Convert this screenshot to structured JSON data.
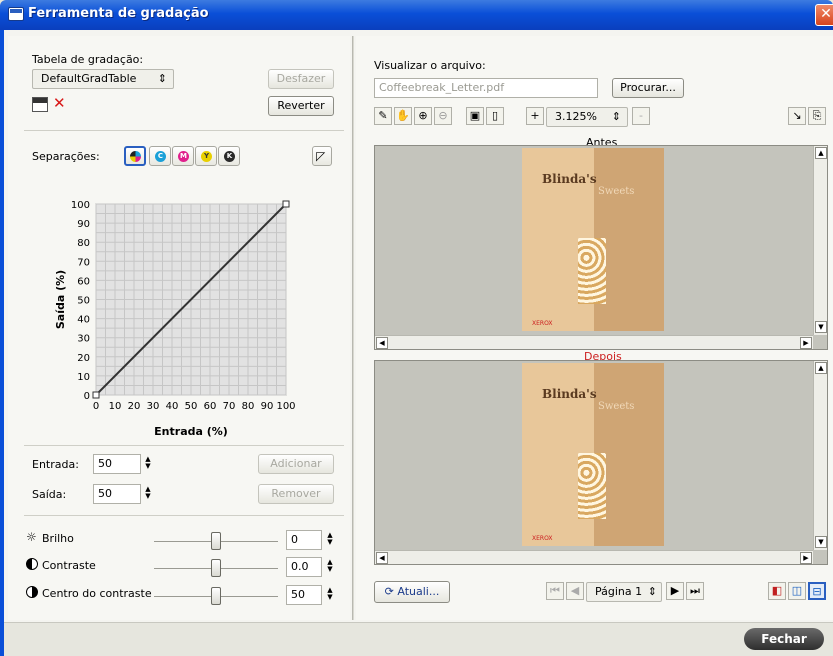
{
  "window": {
    "title": "Ferramenta de gradação",
    "close_glyph": "✕"
  },
  "left": {
    "gradation_table_label": "Tabela de gradação:",
    "gradation_table_value": "DefaultGradTable",
    "undo_label": "Desfazer",
    "revert_label": "Reverter",
    "separations_label": "Separações:",
    "separations": [
      {
        "name": "CMYK",
        "color": "#000000"
      },
      {
        "name": "C",
        "glyph": "C",
        "color": "#1aa0d8"
      },
      {
        "name": "M",
        "glyph": "M",
        "color": "#e0208c"
      },
      {
        "name": "Y",
        "glyph": "Y",
        "color": "#e8d000"
      },
      {
        "name": "K",
        "glyph": "K",
        "color": "#2a2a2a"
      }
    ],
    "input_label": "Entrada:",
    "input_value": "50",
    "output_label": "Saída:",
    "output_value": "50",
    "add_label": "Adicionar",
    "remove_label": "Remover",
    "brightness_label": "Brilho",
    "brightness_value": "0",
    "contrast_label": "Contraste",
    "contrast_value": "0.0",
    "contrast_center_label": "Centro do contraste",
    "contrast_center_value": "50"
  },
  "chart_data": {
    "type": "line",
    "xlabel": "Entrada (%)",
    "ylabel": "Saída (%)",
    "xlim": [
      0,
      100
    ],
    "ylim": [
      0,
      100
    ],
    "x_ticks": [
      "0",
      "10",
      "20",
      "30",
      "40",
      "50",
      "60",
      "70",
      "80",
      "90",
      "100"
    ],
    "y_ticks": [
      "0",
      "10",
      "20",
      "30",
      "40",
      "50",
      "60",
      "70",
      "80",
      "90",
      "100"
    ],
    "grid": true,
    "series": [
      {
        "x": [
          0,
          100
        ],
        "y": [
          0,
          100
        ]
      }
    ]
  },
  "right": {
    "view_file_label": "Visualizar o arquivo:",
    "file_value": "Coffeebreak_Letter.pdf",
    "browse_label": "Procurar...",
    "zoom_value": "3.125%",
    "zoom_plus": "+",
    "zoom_minus": "-",
    "before_label": "Antes",
    "after_label": "Depois",
    "refresh_label": "Atuali...",
    "page_label": "Página 1",
    "preview_title": "Blinda's",
    "preview_subtitle": "Sweets",
    "preview_brand": "XEROX",
    "accent_after": "#cc2020"
  },
  "footer": {
    "close_label": "Fechar"
  }
}
